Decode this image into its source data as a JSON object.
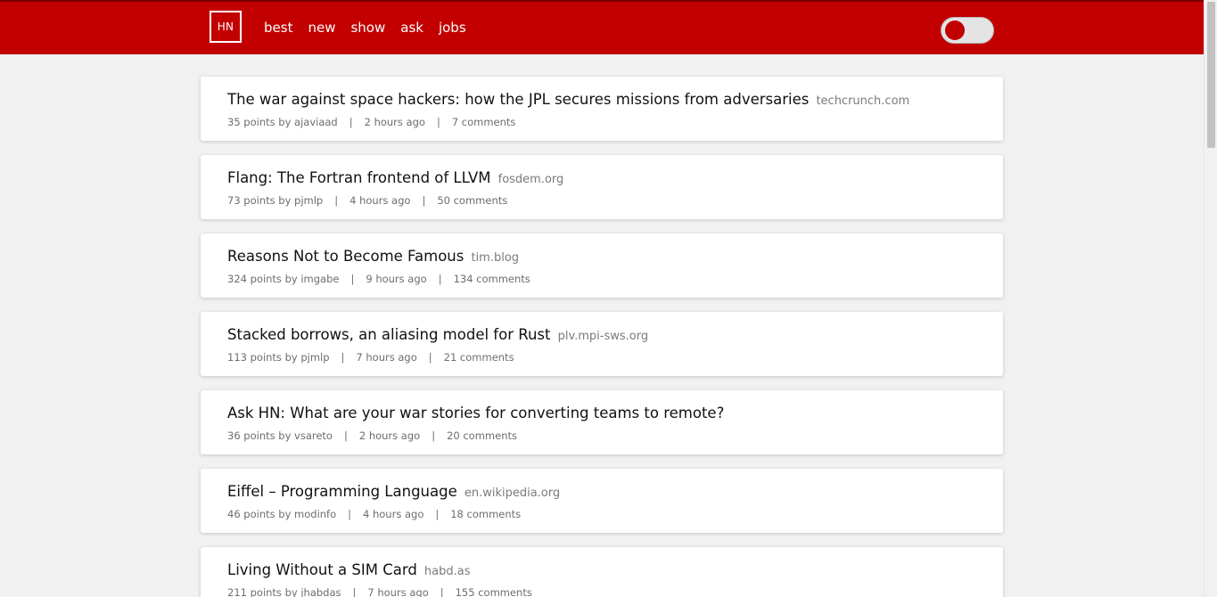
{
  "header": {
    "logo": "HN",
    "nav": [
      "best",
      "new",
      "show",
      "ask",
      "jobs"
    ],
    "theme_toggle_on": false,
    "colors": {
      "brand": "#c20000",
      "background": "#f1f1f1",
      "card": "#ffffff"
    }
  },
  "stories": [
    {
      "title": "The war against space hackers: how the JPL secures missions from adversaries",
      "domain": "techcrunch.com",
      "byline": "35 points by ajaviaad",
      "time": "2 hours ago",
      "comments": "7 comments"
    },
    {
      "title": "Flang: The Fortran frontend of LLVM",
      "domain": "fosdem.org",
      "byline": "73 points by pjmlp",
      "time": "4 hours ago",
      "comments": "50 comments"
    },
    {
      "title": "Reasons Not to Become Famous",
      "domain": "tim.blog",
      "byline": "324 points by imgabe",
      "time": "9 hours ago",
      "comments": "134 comments"
    },
    {
      "title": "Stacked borrows, an aliasing model for Rust",
      "domain": "plv.mpi-sws.org",
      "byline": "113 points by pjmlp",
      "time": "7 hours ago",
      "comments": "21 comments"
    },
    {
      "title": "Ask HN: What are your war stories for converting teams to remote?",
      "domain": "",
      "byline": "36 points by vsareto",
      "time": "2 hours ago",
      "comments": "20 comments"
    },
    {
      "title": "Eiffel – Programming Language",
      "domain": "en.wikipedia.org",
      "byline": "46 points by modinfo",
      "time": "4 hours ago",
      "comments": "18 comments"
    },
    {
      "title": "Living Without a SIM Card",
      "domain": "habd.as",
      "byline": "211 points by jhabdas",
      "time": "7 hours ago",
      "comments": "155 comments"
    }
  ]
}
